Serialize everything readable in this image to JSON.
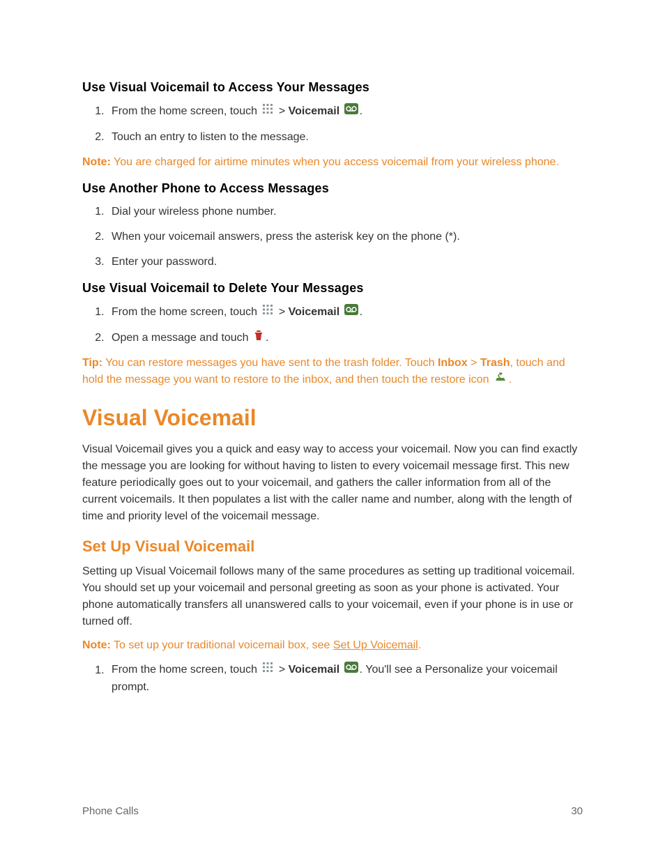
{
  "sections": {
    "access": {
      "heading": "Use Visual Voicemail to Access Your Messages",
      "step1_a": "From the home screen, touch ",
      "step1_b": " > ",
      "step1_voicemail": "Voicemail",
      "step1_c": " ",
      "step1_d": ".",
      "step2": "Touch an entry to listen to the message."
    },
    "note1": {
      "label": "Note:",
      "text": " You are charged for airtime minutes when you access voicemail from your wireless phone."
    },
    "another": {
      "heading": "Use Another Phone to Access Messages",
      "step1": "Dial your wireless phone number.",
      "step2": "When your voicemail answers, press the asterisk key on the phone (*).",
      "step3": "Enter your password."
    },
    "delete": {
      "heading": "Use Visual Voicemail to Delete Your Messages",
      "step1_a": "From the home screen, touch ",
      "step1_b": " > ",
      "step1_voicemail": "Voicemail",
      "step1_c": " ",
      "step1_d": ".",
      "step2_a": "Open a message and touch ",
      "step2_b": "."
    },
    "tip1": {
      "label": "Tip:",
      "text1": " You can restore messages you have sent to the trash folder. Touch ",
      "inbox": "Inbox",
      "gt": " > ",
      "trash": "Trash",
      "text2": ", touch and hold the message you want to restore to the inbox, and then touch the restore icon ",
      "text3": "."
    },
    "visual": {
      "heading": "Visual Voicemail",
      "para": "Visual Voicemail gives you a quick and easy way to access your voicemail. Now you can find exactly the message you are looking for without having to listen to every voicemail message first. This new feature periodically goes out to your voicemail, and gathers the caller information from all of the current voicemails. It then populates a list with the caller name and number, along with the length of time and priority level of the voicemail message."
    },
    "setup": {
      "heading": "Set Up Visual Voicemail",
      "para": "Setting up Visual Voicemail follows many of the same procedures as setting up traditional voicemail. You should set up your voicemail and personal greeting as soon as your phone is activated. Your phone automatically transfers all unanswered calls to your voicemail, even if your phone is in use or turned off.",
      "note_label": "Note:",
      "note_text1": " To set up your traditional voicemail box, see ",
      "note_link": "Set Up Voicemail",
      "note_text2": ".",
      "step1_a": "From the home screen, touch ",
      "step1_b": " > ",
      "step1_voicemail": "Voicemail",
      "step1_c": " ",
      "step1_d": ". You'll see a Personalize your voicemail prompt."
    }
  },
  "footer": {
    "left": "Phone Calls",
    "right": "30"
  }
}
